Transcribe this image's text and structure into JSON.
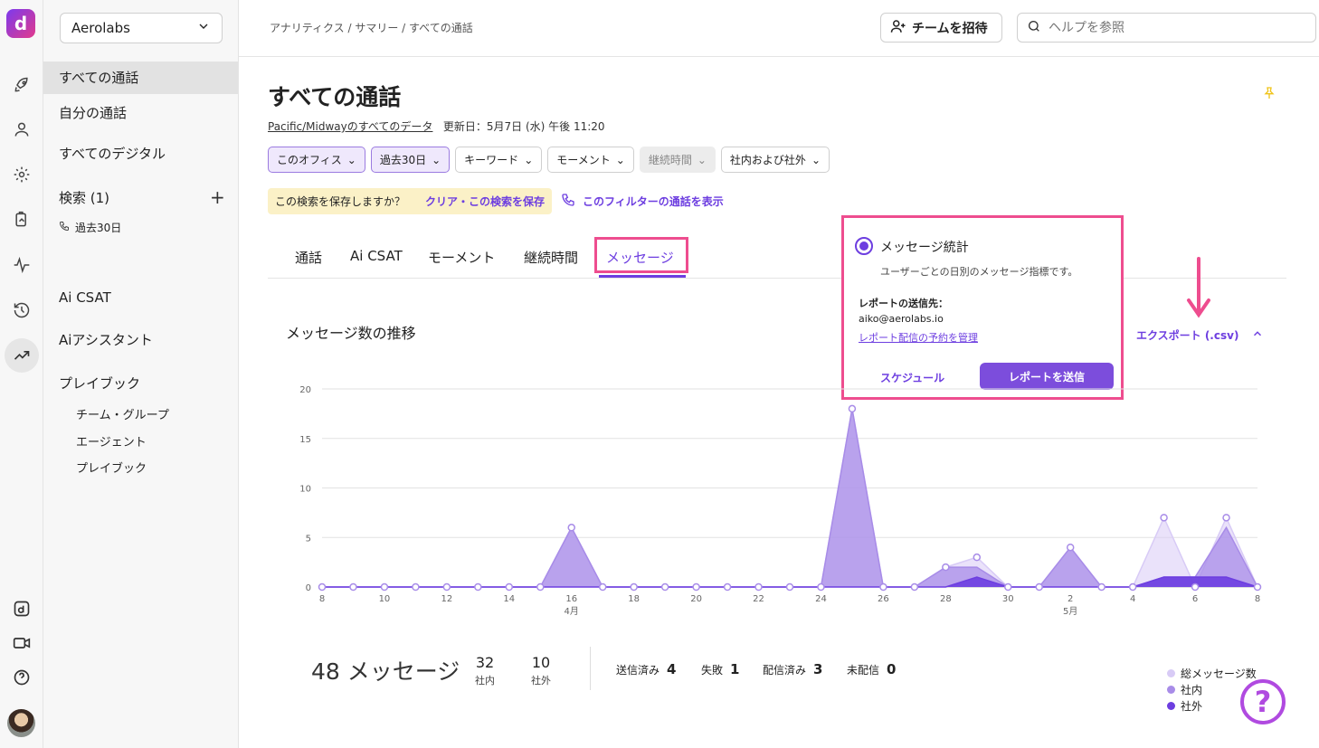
{
  "app": {
    "org": "Aerolabs",
    "logo": "d"
  },
  "rail_icons": [
    "rocket-icon",
    "user-icon",
    "gear-icon",
    "report-icon",
    "activity-icon",
    "history-icon",
    "trend-icon",
    "brand-icon",
    "video-icon",
    "help-icon"
  ],
  "sidebar": {
    "all_calls": "すべての通話",
    "my_calls": "自分の通話",
    "all_digital": "すべてのデジタル",
    "search_header": "検索 (1)",
    "search_item": "過去30日",
    "ai_csat": "Ai CSAT",
    "ai_assistant": "Aiアシスタント",
    "playbook": "プレイブック",
    "sub_items": [
      "チーム・グループ",
      "エージェント",
      "プレイブック"
    ]
  },
  "topbar": {
    "breadcrumb": "アナリティクス / サマリー / すべての通話",
    "invite": "チームを招待",
    "search_placeholder": "ヘルプを参照"
  },
  "page": {
    "title": "すべての通話",
    "data_scope": "Pacific/Midwayのすべてのデータ",
    "updated": "更新日：5月7日 (水) 午後 11:20"
  },
  "filters": [
    {
      "label": "このオフィス",
      "state": "on"
    },
    {
      "label": "過去30日",
      "state": "on"
    },
    {
      "label": "キーワード",
      "state": "normal"
    },
    {
      "label": "モーメント",
      "state": "normal"
    },
    {
      "label": "継続時間",
      "state": "off"
    },
    {
      "label": "社内および社外",
      "state": "normal"
    }
  ],
  "save_search": {
    "question": "この検索を保存しますか？",
    "action": "クリア・この検索を保存"
  },
  "show_calls": "このフィルターの通話を表示",
  "tabs": [
    "通話",
    "Ai CSAT",
    "モーメント",
    "継続時間",
    "メッセージ"
  ],
  "active_tab": "メッセージ",
  "chart_title": "メッセージ数の推移",
  "export": "エクスポート (.csv)",
  "popup": {
    "title": "メッセージ統計",
    "desc": "ユーザーごとの日別のメッセージ指標です。",
    "send_to_label": "レポートの送信先：",
    "email": "aiko@aerolabs.io",
    "manage_link": "レポート配信の予約を管理",
    "schedule": "スケジュール",
    "send": "レポートを送信"
  },
  "chart_data": {
    "type": "area",
    "ylim": [
      0,
      20
    ],
    "yticks": [
      0,
      5,
      10,
      15,
      20
    ],
    "x": [
      "8",
      "9",
      "10",
      "11",
      "12",
      "13",
      "14",
      "15",
      "16",
      "17",
      "18",
      "19",
      "20",
      "21",
      "22",
      "23",
      "24",
      "25",
      "26",
      "27",
      "28",
      "29",
      "30",
      "1",
      "2",
      "3",
      "4",
      "5",
      "6",
      "7",
      "8"
    ],
    "xtick_labels": [
      "8",
      "10",
      "12",
      "14",
      "16",
      "18",
      "20",
      "22",
      "24",
      "26",
      "28",
      "30",
      "2",
      "4",
      "6",
      "8"
    ],
    "month_labels": [
      {
        "at": "16",
        "label": "4月"
      },
      {
        "at": "2",
        "label": "5月"
      }
    ],
    "series": [
      {
        "name": "総メッセージ数",
        "color": "#d8cbf6",
        "values": [
          0,
          0,
          0,
          0,
          0,
          0,
          0,
          0,
          6,
          0,
          0,
          0,
          0,
          0,
          0,
          0,
          0,
          18,
          0,
          0,
          2,
          3,
          0,
          0,
          4,
          0,
          0,
          7,
          0,
          7,
          0
        ]
      },
      {
        "name": "社内",
        "color": "#a88ce8",
        "values": [
          0,
          0,
          0,
          0,
          0,
          0,
          0,
          0,
          6,
          0,
          0,
          0,
          0,
          0,
          0,
          0,
          0,
          18,
          0,
          0,
          2,
          2,
          0,
          0,
          4,
          0,
          0,
          1,
          1,
          6,
          0
        ]
      },
      {
        "name": "社外",
        "color": "#6d3ee0",
        "values": [
          0,
          0,
          0,
          0,
          0,
          0,
          0,
          0,
          0,
          0,
          0,
          0,
          0,
          0,
          0,
          0,
          0,
          0,
          0,
          0,
          0,
          1,
          0,
          0,
          0,
          0,
          0,
          1,
          1,
          1,
          0
        ]
      }
    ]
  },
  "summary": {
    "total": "48 メッセージ",
    "internal_n": "32",
    "internal_l": "社内",
    "external_n": "10",
    "external_l": "社外",
    "sent_l": "送信済み",
    "sent_n": "4",
    "failed_l": "失敗",
    "failed_n": "1",
    "delivered_l": "配信済み",
    "delivered_n": "3",
    "undelivered_l": "未配信",
    "undelivered_n": "0"
  }
}
